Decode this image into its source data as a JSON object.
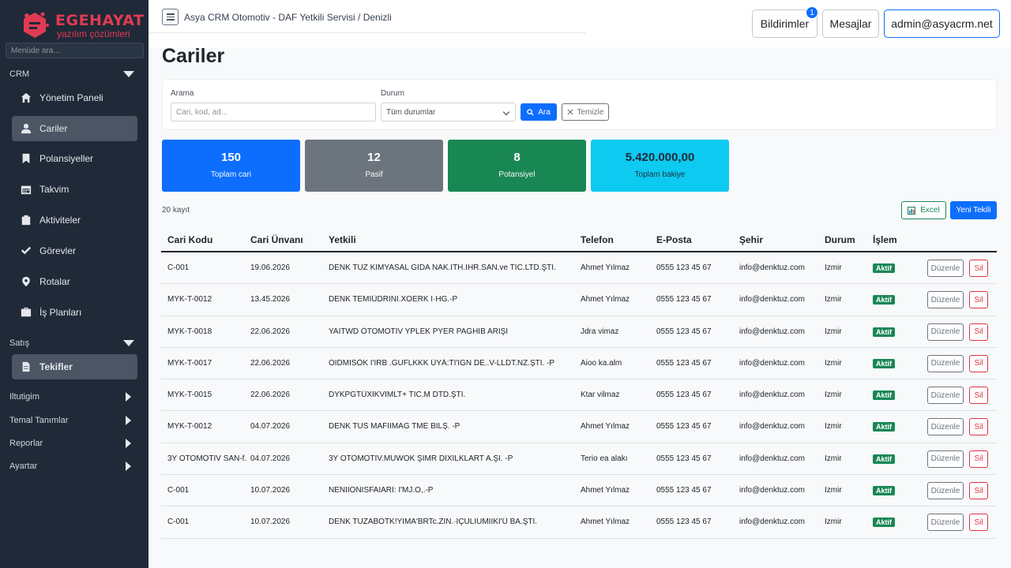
{
  "brand": {
    "name": "EGEHAYAT",
    "sub": "yazılım çözümleri",
    "color": "#e03b52"
  },
  "sidebar": {
    "search_placeholder": "Menüde ara...",
    "sections": [
      {
        "label": "CRM",
        "state": "expanded"
      },
      {
        "label": "Satış",
        "state": "expanded"
      },
      {
        "label": "Iltutigim",
        "state": "collapsed"
      },
      {
        "label": "Temal Tanımlar",
        "state": "collapsed"
      },
      {
        "label": "Reporlar",
        "state": "collapsed"
      },
      {
        "label": "Ayartar",
        "state": "collapsed"
      }
    ],
    "items": [
      {
        "label": "Yönetim Paneli",
        "icon": "home-icon"
      },
      {
        "label": "Cariler",
        "icon": "user-icon",
        "active": true
      },
      {
        "label": "Polansiyeller",
        "icon": "bookmark-icon"
      },
      {
        "label": "Takvim",
        "icon": "calendar-icon"
      },
      {
        "label": "Aktiviteler",
        "icon": "clipboard-icon"
      },
      {
        "label": "Görevler",
        "icon": "check-icon"
      },
      {
        "label": "Rotalar",
        "icon": "map-pin-icon"
      },
      {
        "label": "İş Planları",
        "icon": "briefcase-icon"
      },
      {
        "label": "Tekifler",
        "icon": "document-icon",
        "active": true
      }
    ]
  },
  "topbar": {
    "breadcrumb": "Asya CRM Otomotiv - DAF Yetkili Servisi / Denizli",
    "notifications_label": "Bildirimler",
    "notifications_count": "1",
    "messages_label": "Mesajlar",
    "user_label": "admin@asyacrm.net"
  },
  "page": {
    "title": "Cariler",
    "filter": {
      "search_label": "Arama",
      "search_placeholder": "Cari, kod, ad...",
      "status_label": "Durum",
      "status_value": "Tüm durumlar",
      "search_button": "Ara",
      "clear_button": "Temizle"
    },
    "stats": [
      {
        "value": "150",
        "label": "Toplam cari",
        "color": "#0d6efd"
      },
      {
        "value": "12",
        "label": "Pasif",
        "color": "#6c757d"
      },
      {
        "value": "8",
        "label": "Potansiyel",
        "color": "#198754"
      },
      {
        "value": "5.420.000,00",
        "label": "Toplam bakiye",
        "color": "#0dcaf0"
      }
    ],
    "record_count": "20 kayıt",
    "excel_button": "Excel",
    "new_button": "Yeni Tekili"
  },
  "table": {
    "headers": [
      "Cari Kodu",
      "Cari Ünvanı",
      "Yetkili",
      "Telefon",
      "E-Posta",
      "Şehir",
      "Durum",
      "İşlem"
    ],
    "edit_label": "Düzenle",
    "delete_label": "Sil",
    "rows": [
      {
        "code": "C-001",
        "date": "19.06.2026",
        "title": "DENK TUZ KİMYASAL GIDA NAK.İTH.İHR.SAN.ve TİC.LTD.ŞTİ.",
        "contact": "Ahmet Yılmaz",
        "phone": "0555 123 45 67",
        "email": "info@denktuz.com",
        "city": "İzmir",
        "status": "Aktif"
      },
      {
        "code": "MYK-T-0012",
        "date": "13.45.2026",
        "title": "DENK TEMIÜDRINI.XOERK I·HG.-P",
        "contact": "Ahmet Yılmaz",
        "phone": "0555 123 45 67",
        "email": "info@denktuz.com",
        "city": "İzmir",
        "status": "Aktif"
      },
      {
        "code": "MYK-T-0018",
        "date": "22.06.2026",
        "title": "YAITWD ÖTOMOTİV YPLEK PYER PAĞHİB ARİŞİ",
        "contact": "Jdra vimaz",
        "phone": "0555 123 45 67",
        "email": "info@denktuz.com",
        "city": "İzmir",
        "status": "Aktif"
      },
      {
        "code": "MYK-T-0017",
        "date": "22.06.2026",
        "title": "OIDMISÖK I'IRB .GUFLKKK ÜYÄ:TI'IGN DE..V-LLDT.NZ.ŞTİ. -P",
        "contact": "Aioo ka.alm",
        "phone": "0555 123 45 67",
        "email": "info@denktuz.com",
        "city": "İzmir",
        "status": "Aktif"
      },
      {
        "code": "MYK-T-0015",
        "date": "22.06.2026",
        "title": "DYKPGTÜXIKVIMLT+ TİC.M DTD.ŞTİ.",
        "contact": "Ktar vilmaz",
        "phone": "0555 123 45 67",
        "email": "info@denktuz.com",
        "city": "İzmir",
        "status": "Aktif"
      },
      {
        "code": "MYK-T-0012",
        "date": "04.07.2026",
        "title": "DENK TUS MAFIIMAG TME BİLŞ. -P",
        "contact": "Ahmet Yılmaz",
        "phone": "0555 123 45 67",
        "email": "info@denktuz.com",
        "city": "İzmir",
        "status": "Aktif"
      },
      {
        "code": "3Y OTOMOTİV SAN-f..",
        "date": "04.07.2026",
        "title": "3Y OTOMOTİV.MUWOK ŞIMR DIXILKLART A.ŞI. -P",
        "contact": "Terio ea alakı",
        "phone": "0555 123 45 67",
        "email": "info@denktuz.com",
        "city": "İzmir",
        "status": "Aktif"
      },
      {
        "code": "C-001",
        "date": "10.07.2026",
        "title": "NENİIONİSFAIARİ: I'MJ.O,.-P",
        "contact": "Ahmet Yılmaz",
        "phone": "0555 123 45 67",
        "email": "info@denktuz.com",
        "city": "İzmir",
        "status": "Aktif"
      },
      {
        "code": "C-001",
        "date": "10.07.2026",
        "title": "DENK TUZABOTK!YIMA'BRTc.ZIN.·İÇULIUMIIKI'Ü BA.ŞTİ.",
        "contact": "Ahmet Yılmaz",
        "phone": "0555 123 45 67",
        "email": "info@denktuz.com",
        "city": "İzmir",
        "status": "Aktif"
      }
    ]
  }
}
